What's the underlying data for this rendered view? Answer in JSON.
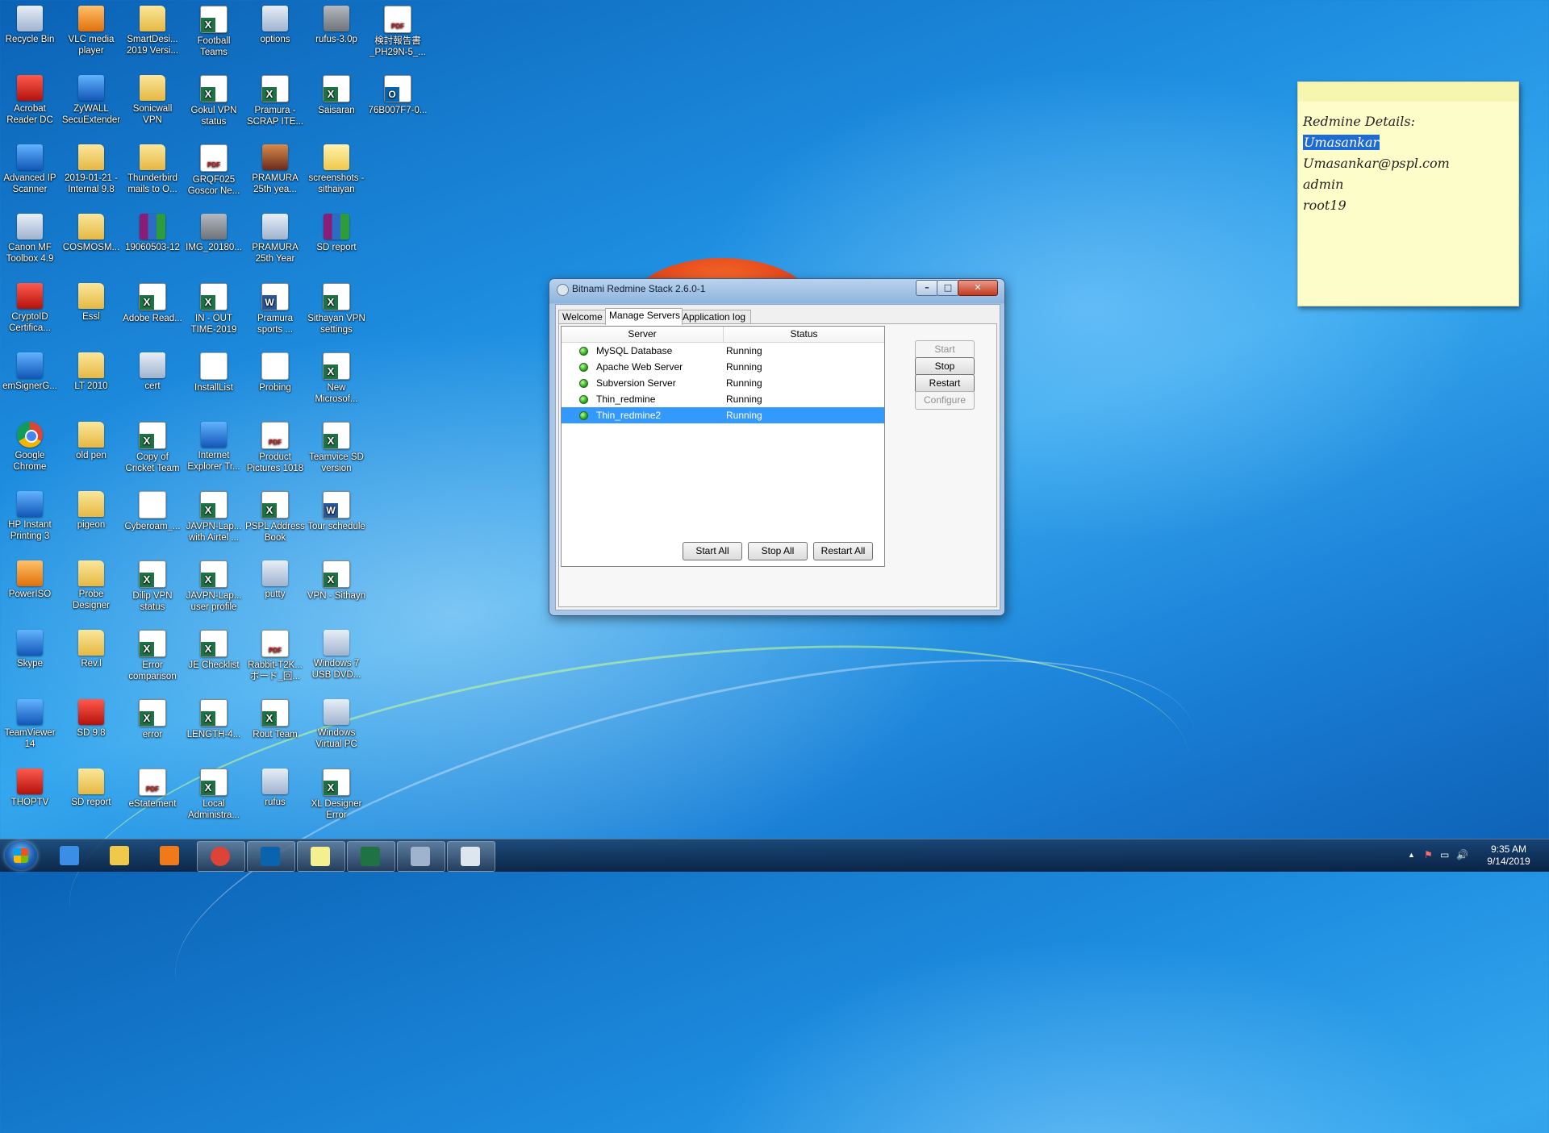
{
  "desktop_icons": [
    {
      "label": "Recycle Bin",
      "type": "app"
    },
    {
      "label": "VLC media player",
      "type": "orange"
    },
    {
      "label": "SmartDesi... 2019 Versi...",
      "type": "folder"
    },
    {
      "label": "Football Teams",
      "type": "excel"
    },
    {
      "label": "options",
      "type": "app"
    },
    {
      "label": "rufus-3.0p",
      "type": "gray"
    },
    {
      "label": "検討報告書_PH29N-5_...",
      "type": "pdf"
    },
    {
      "label": "Acrobat Reader DC",
      "type": "red"
    },
    {
      "label": "ZyWALL SecuExtender",
      "type": "blue"
    },
    {
      "label": "Sonicwall VPN",
      "type": "folder"
    },
    {
      "label": "Gokul VPN status",
      "type": "excel"
    },
    {
      "label": "Pramura - SCRAP ITE...",
      "type": "excel"
    },
    {
      "label": "Saisaran",
      "type": "excel"
    },
    {
      "label": "76B007F7-0...",
      "type": "outlook"
    },
    {
      "label": "Advanced IP Scanner",
      "type": "blue"
    },
    {
      "label": "2019-01-21 - Internal 9.8",
      "type": "folder"
    },
    {
      "label": "Thunderbird mails to O...",
      "type": "folder"
    },
    {
      "label": "GRQF025 Goscor Ne...",
      "type": "pdf"
    },
    {
      "label": "PRAMURA 25th yea...",
      "type": "photo"
    },
    {
      "label": "screenshots - sithaiyan",
      "type": "mail"
    },
    {
      "label": "Canon MF Toolbox 4.9",
      "type": "app"
    },
    {
      "label": "COSMOSM...",
      "type": "folder"
    },
    {
      "label": "19060503-12",
      "type": "rar"
    },
    {
      "label": "IMG_20180...",
      "type": "gray"
    },
    {
      "label": "PRAMURA 25th Year",
      "type": "app"
    },
    {
      "label": "SD report",
      "type": "rar"
    },
    {
      "label": "CryptoID Certifica...",
      "type": "red"
    },
    {
      "label": "Essl",
      "type": "folder"
    },
    {
      "label": "Adobe Read...",
      "type": "excel"
    },
    {
      "label": "IN - OUT TIME-2019",
      "type": "excel"
    },
    {
      "label": "Pramura sports ...",
      "type": "word"
    },
    {
      "label": "Sithayan VPN settings",
      "type": "excel"
    },
    {
      "label": "emSignerG...",
      "type": "blue"
    },
    {
      "label": "LT 2010",
      "type": "folder"
    },
    {
      "label": "cert",
      "type": "app"
    },
    {
      "label": "InstallList",
      "type": "file"
    },
    {
      "label": "Probing",
      "type": "file"
    },
    {
      "label": "New Microsof...",
      "type": "excel"
    },
    {
      "label": "Google Chrome",
      "type": "chrome"
    },
    {
      "label": "old pen",
      "type": "folder"
    },
    {
      "label": "Copy of Cricket Team",
      "type": "excel"
    },
    {
      "label": "Internet Explorer Tr...",
      "type": "blue"
    },
    {
      "label": "Product Pictures 1018",
      "type": "pdf"
    },
    {
      "label": "Teamvice SD version",
      "type": "excel"
    },
    {
      "label": "HP Instant Printing 3",
      "type": "blue"
    },
    {
      "label": "pigeon",
      "type": "folder"
    },
    {
      "label": "Cyberoam_...",
      "type": "file"
    },
    {
      "label": "JAVPN-Lap... with Airtel ...",
      "type": "excel"
    },
    {
      "label": "PSPL Address Book",
      "type": "excel"
    },
    {
      "label": "Tour schedule",
      "type": "word"
    },
    {
      "label": "PowerISO",
      "type": "orange"
    },
    {
      "label": "Probe Designer",
      "type": "folder"
    },
    {
      "label": "Dilip VPN status",
      "type": "excel"
    },
    {
      "label": "JAVPN-Lap... user profile",
      "type": "excel"
    },
    {
      "label": "putty",
      "type": "app"
    },
    {
      "label": "VPN - Sithayn",
      "type": "excel"
    },
    {
      "label": "Skype",
      "type": "blue"
    },
    {
      "label": "Rev.l",
      "type": "folder"
    },
    {
      "label": "Error comparison",
      "type": "excel"
    },
    {
      "label": "JE  Checklist",
      "type": "excel"
    },
    {
      "label": "Rabbit-T2K... ボード_回...",
      "type": "pdf"
    },
    {
      "label": "Windows 7 USB DVD...",
      "type": "app"
    },
    {
      "label": "TeamViewer 14",
      "type": "blue"
    },
    {
      "label": "SD 9.8",
      "type": "red"
    },
    {
      "label": "error",
      "type": "excel"
    },
    {
      "label": "LENGTH-4...",
      "type": "excel"
    },
    {
      "label": "Rout Team",
      "type": "excel"
    },
    {
      "label": "Windows Virtual PC",
      "type": "app"
    },
    {
      "label": "THOPTV",
      "type": "red"
    },
    {
      "label": "SD report",
      "type": "folder"
    },
    {
      "label": "eStatement",
      "type": "pdf"
    },
    {
      "label": "Local Administra...",
      "type": "excel"
    },
    {
      "label": "rufus",
      "type": "app"
    },
    {
      "label": "XL Designer Error",
      "type": "excel"
    }
  ],
  "sticky_note": {
    "lines": [
      "Redmine Details:",
      "Umasankar",
      "Umasankar@pspl.com",
      "admin",
      "root19"
    ]
  },
  "window": {
    "title": "Bitnami Redmine Stack 2.6.0-1",
    "caption_buttons": {
      "minimize": "–",
      "maximize": "□",
      "close": "✕"
    },
    "tabs": [
      {
        "label": "Welcome",
        "active": false
      },
      {
        "label": "Manage Servers",
        "active": true
      },
      {
        "label": "Application log",
        "active": false
      }
    ],
    "columns": {
      "server": "Server",
      "status": "Status"
    },
    "servers": [
      {
        "name": "MySQL Database",
        "status": "Running",
        "selected": false
      },
      {
        "name": "Apache Web Server",
        "status": "Running",
        "selected": false
      },
      {
        "name": "Subversion Server",
        "status": "Running",
        "selected": false
      },
      {
        "name": "Thin_redmine",
        "status": "Running",
        "selected": false
      },
      {
        "name": "Thin_redmine2",
        "status": "Running",
        "selected": true
      }
    ],
    "side_buttons": {
      "start": "Start",
      "stop": "Stop",
      "restart": "Restart",
      "configure": "Configure"
    },
    "bottom_buttons": {
      "start_all": "Start All",
      "stop_all": "Stop All",
      "restart_all": "Restart All"
    }
  },
  "taskbar": {
    "apps": [
      {
        "name": "internet-explorer",
        "color": "#3a8ee6",
        "open": false
      },
      {
        "name": "file-explorer",
        "color": "#f0c84a",
        "open": false
      },
      {
        "name": "media-player",
        "color": "#f07a1a",
        "open": false
      },
      {
        "name": "google-chrome",
        "color": "#db4437",
        "open": true
      },
      {
        "name": "outlook",
        "color": "#0a64ad",
        "open": true
      },
      {
        "name": "sticky-notes",
        "color": "#f4ef8f",
        "open": true
      },
      {
        "name": "excel",
        "color": "#1f7244",
        "open": true
      },
      {
        "name": "remote-desktop",
        "color": "#9fb3cf",
        "open": true
      },
      {
        "name": "bitnami-manager",
        "color": "#dde5ef",
        "open": true
      }
    ],
    "tray": {
      "up_arrow": "▲",
      "flag": "⚑",
      "network": "▭",
      "volume": "🔊"
    },
    "clock": {
      "time": "9:35 AM",
      "date": "9/14/2019"
    }
  }
}
